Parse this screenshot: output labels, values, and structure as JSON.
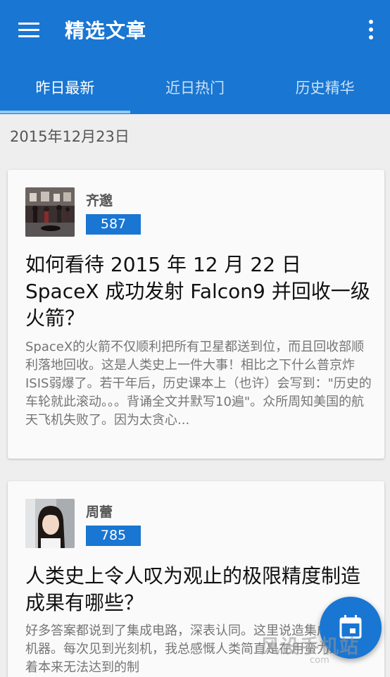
{
  "appbar": {
    "title": "精选文章",
    "menu_icon": "hamburger-menu-icon",
    "more_icon": "more-vertical-icon",
    "color": "#1976d2"
  },
  "tabs": [
    {
      "label": "昨日最新",
      "active": true
    },
    {
      "label": "近日热门",
      "active": false
    },
    {
      "label": "历史精华",
      "active": false
    }
  ],
  "date": "2015年12月23日",
  "articles": [
    {
      "author": "齐邈",
      "votes": "587",
      "title": "如何看待 2015 年 12 月 22 日 SpaceX 成功发射 Falcon9 并回收一级火箭？",
      "excerpt": "SpaceX的火箭不仅顺利把所有卫星都送到位，而且回收部顺利落地回收。这是人类史上一件大事！相比之下什么普京炸ISIS弱爆了。若干年后，历史课本上（也许）会写到：\"历史的车轮就此滚动。。。背诵全文并默写10遍\"。众所周知美国的航天飞机失败了。因为太贪心..."
    },
    {
      "author": "周蕾",
      "votes": "785",
      "title": "人类史上令人叹为观止的极限精度制造成果有哪些？",
      "excerpt": "好多答案都说到了集成电路，深表认同。这里说造集成电路的机器。每次见到光刻机，我总感慨人类简直是在用蛮力来实现着本来无法达到的制"
    }
  ],
  "fab": {
    "icon": "calendar-icon"
  },
  "watermark": {
    "text": "风设手机站",
    "sub": "com"
  }
}
